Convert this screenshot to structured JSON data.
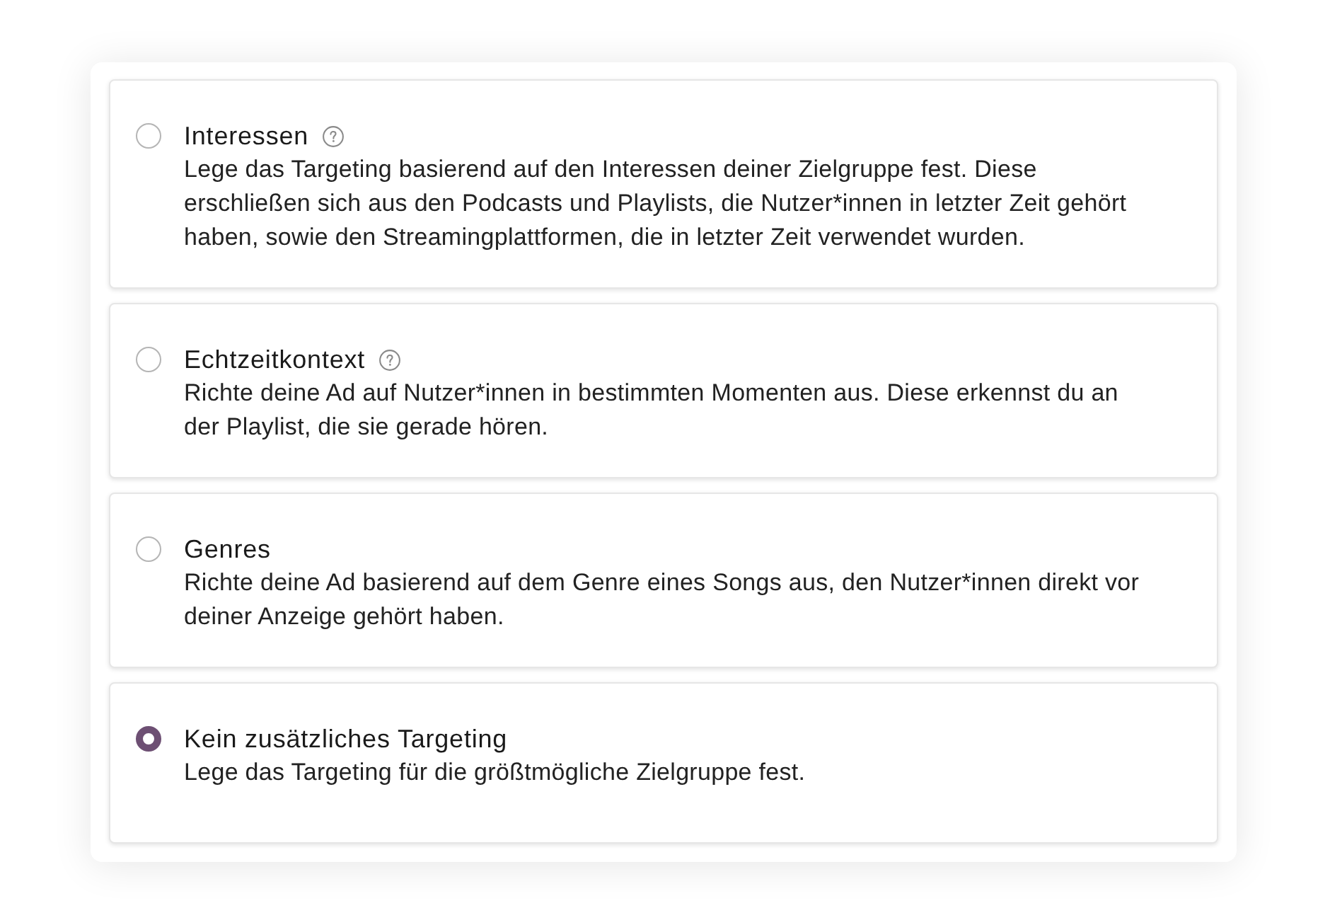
{
  "options": [
    {
      "title": "Interessen",
      "help": true,
      "description": "Lege das Targeting basierend auf den Interessen deiner Zielgruppe fest. Diese erschließen sich aus den Podcasts und Playlists, die Nutzer*innen in letzter Zeit gehört haben, sowie den Streamingplattformen, die in letzter Zeit verwendet wurden.",
      "selected": false
    },
    {
      "title": "Echtzeitkontext",
      "help": true,
      "description": "Richte deine Ad auf Nutzer*innen in bestimmten Momenten aus. Diese erkennst du an der Playlist, die sie gerade hören.",
      "selected": false
    },
    {
      "title": "Genres",
      "help": false,
      "description": "Richte deine Ad basierend auf dem Genre eines Songs aus, den Nutzer*innen direkt vor deiner Anzeige gehört haben.",
      "selected": false
    },
    {
      "title": "Kein zusätzliches Targeting",
      "help": false,
      "description": "Lege das Targeting für die größtmögliche Zielgruppe fest.",
      "selected": true
    }
  ]
}
